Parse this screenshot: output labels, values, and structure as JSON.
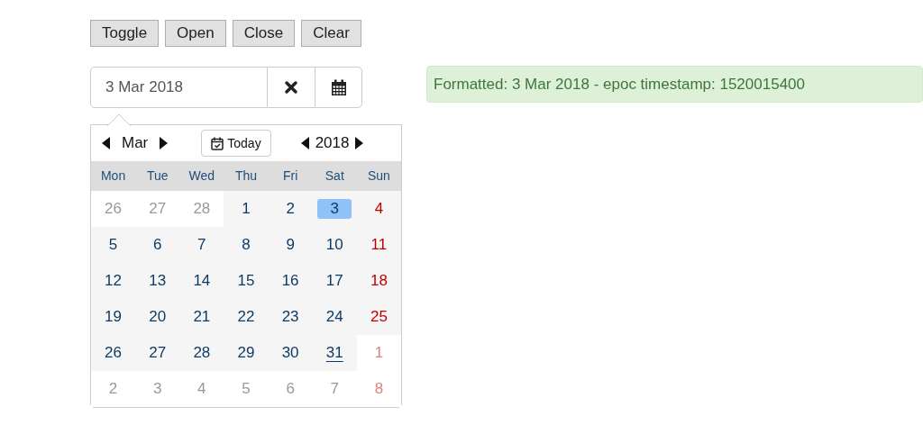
{
  "buttons": [
    "Toggle",
    "Open",
    "Close",
    "Clear"
  ],
  "date_input": {
    "value": "3 Mar 2018"
  },
  "alert": {
    "text": "Formatted: 3 Mar 2018 - epoc timestamp: 1520015400"
  },
  "calendar": {
    "month": "Mar",
    "today_button": "Today",
    "year": "2018",
    "weekdays": [
      "Mon",
      "Tue",
      "Wed",
      "Thu",
      "Fri",
      "Sat",
      "Sun"
    ],
    "weeks": [
      [
        {
          "label": "26",
          "in_month": false,
          "weekend": false,
          "selected": false,
          "today": false
        },
        {
          "label": "27",
          "in_month": false,
          "weekend": false,
          "selected": false,
          "today": false
        },
        {
          "label": "28",
          "in_month": false,
          "weekend": false,
          "selected": false,
          "today": false
        },
        {
          "label": "1",
          "in_month": true,
          "weekend": false,
          "selected": false,
          "today": false
        },
        {
          "label": "2",
          "in_month": true,
          "weekend": false,
          "selected": false,
          "today": false
        },
        {
          "label": "3",
          "in_month": true,
          "weekend": false,
          "selected": true,
          "today": false
        },
        {
          "label": "4",
          "in_month": true,
          "weekend": true,
          "selected": false,
          "today": false
        }
      ],
      [
        {
          "label": "5",
          "in_month": true,
          "weekend": false,
          "selected": false,
          "today": false
        },
        {
          "label": "6",
          "in_month": true,
          "weekend": false,
          "selected": false,
          "today": false
        },
        {
          "label": "7",
          "in_month": true,
          "weekend": false,
          "selected": false,
          "today": false
        },
        {
          "label": "8",
          "in_month": true,
          "weekend": false,
          "selected": false,
          "today": false
        },
        {
          "label": "9",
          "in_month": true,
          "weekend": false,
          "selected": false,
          "today": false
        },
        {
          "label": "10",
          "in_month": true,
          "weekend": false,
          "selected": false,
          "today": false
        },
        {
          "label": "11",
          "in_month": true,
          "weekend": true,
          "selected": false,
          "today": false
        }
      ],
      [
        {
          "label": "12",
          "in_month": true,
          "weekend": false,
          "selected": false,
          "today": false
        },
        {
          "label": "13",
          "in_month": true,
          "weekend": false,
          "selected": false,
          "today": false
        },
        {
          "label": "14",
          "in_month": true,
          "weekend": false,
          "selected": false,
          "today": false
        },
        {
          "label": "15",
          "in_month": true,
          "weekend": false,
          "selected": false,
          "today": false
        },
        {
          "label": "16",
          "in_month": true,
          "weekend": false,
          "selected": false,
          "today": false
        },
        {
          "label": "17",
          "in_month": true,
          "weekend": false,
          "selected": false,
          "today": false
        },
        {
          "label": "18",
          "in_month": true,
          "weekend": true,
          "selected": false,
          "today": false
        }
      ],
      [
        {
          "label": "19",
          "in_month": true,
          "weekend": false,
          "selected": false,
          "today": false
        },
        {
          "label": "20",
          "in_month": true,
          "weekend": false,
          "selected": false,
          "today": false
        },
        {
          "label": "21",
          "in_month": true,
          "weekend": false,
          "selected": false,
          "today": false
        },
        {
          "label": "22",
          "in_month": true,
          "weekend": false,
          "selected": false,
          "today": false
        },
        {
          "label": "23",
          "in_month": true,
          "weekend": false,
          "selected": false,
          "today": false
        },
        {
          "label": "24",
          "in_month": true,
          "weekend": false,
          "selected": false,
          "today": false
        },
        {
          "label": "25",
          "in_month": true,
          "weekend": true,
          "selected": false,
          "today": false
        }
      ],
      [
        {
          "label": "26",
          "in_month": true,
          "weekend": false,
          "selected": false,
          "today": false
        },
        {
          "label": "27",
          "in_month": true,
          "weekend": false,
          "selected": false,
          "today": false
        },
        {
          "label": "28",
          "in_month": true,
          "weekend": false,
          "selected": false,
          "today": false
        },
        {
          "label": "29",
          "in_month": true,
          "weekend": false,
          "selected": false,
          "today": false
        },
        {
          "label": "30",
          "in_month": true,
          "weekend": false,
          "selected": false,
          "today": false
        },
        {
          "label": "31",
          "in_month": true,
          "weekend": false,
          "selected": false,
          "today": true
        },
        {
          "label": "1",
          "in_month": false,
          "weekend": true,
          "selected": false,
          "today": false
        }
      ],
      [
        {
          "label": "2",
          "in_month": false,
          "weekend": false,
          "selected": false,
          "today": false
        },
        {
          "label": "3",
          "in_month": false,
          "weekend": false,
          "selected": false,
          "today": false
        },
        {
          "label": "4",
          "in_month": false,
          "weekend": false,
          "selected": false,
          "today": false
        },
        {
          "label": "5",
          "in_month": false,
          "weekend": false,
          "selected": false,
          "today": false
        },
        {
          "label": "6",
          "in_month": false,
          "weekend": false,
          "selected": false,
          "today": false
        },
        {
          "label": "7",
          "in_month": false,
          "weekend": false,
          "selected": false,
          "today": false
        },
        {
          "label": "8",
          "in_month": false,
          "weekend": true,
          "selected": false,
          "today": false
        }
      ]
    ]
  }
}
